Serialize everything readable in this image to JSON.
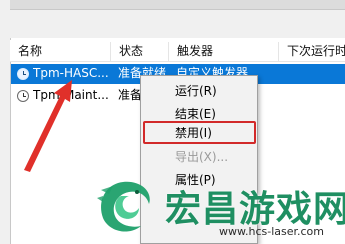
{
  "columns": [
    "名称",
    "状态",
    "触发器",
    "下次运行时"
  ],
  "rows": [
    {
      "name": "Tpm-HASC...",
      "status": "准备就绪",
      "trigger": "自定义触发器",
      "selected": true
    },
    {
      "name": "Tpm-Maint...",
      "status": "准备就",
      "trigger": "",
      "selected": false
    }
  ],
  "context_menu": {
    "items": [
      {
        "label": "运行(R)",
        "enabled": true
      },
      {
        "label": "结束(E)",
        "enabled": true
      },
      {
        "label": "禁用(I)",
        "enabled": true,
        "highlighted": true
      },
      {
        "label": "导出(X)...",
        "enabled": false
      },
      {
        "label": "属性(P)",
        "enabled": true
      }
    ]
  },
  "watermark": {
    "title": "宏昌游戏网",
    "url": "www.hcs-laser.com"
  },
  "colors": {
    "selection": "#0a78d7",
    "highlight_border": "#d22a2a",
    "arrow": "#e0302a",
    "watermark_green": "#1f8f62"
  },
  "icons": {
    "task_icon": "clock-icon",
    "annotation": "red-arrow",
    "logo": "dragon-logo"
  }
}
